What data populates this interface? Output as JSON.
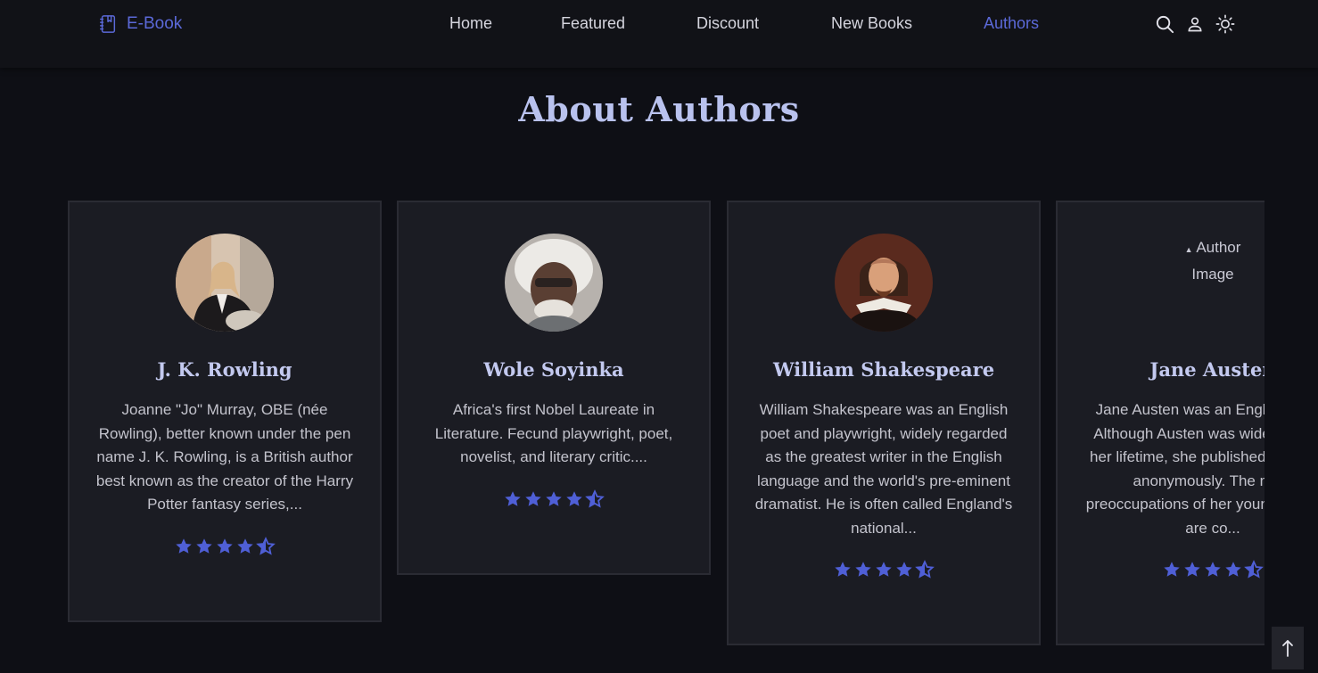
{
  "brand": {
    "name": "E-Book",
    "accent_color": "#5b69d8",
    "icon": "book-icon"
  },
  "nav": {
    "items": [
      {
        "label": "Home",
        "active": false
      },
      {
        "label": "Featured",
        "active": false
      },
      {
        "label": "Discount",
        "active": false
      },
      {
        "label": "New Books",
        "active": false
      },
      {
        "label": "Authors",
        "active": true
      }
    ]
  },
  "header_icons": [
    "search-icon",
    "user-icon",
    "sun-icon"
  ],
  "section": {
    "title": "About Authors"
  },
  "authors": [
    {
      "name": "J. K. Rowling",
      "description": "Joanne \"Jo\" Murray, OBE (née Rowling), better known under the pen name J. K. Rowling, is a British author best known as the creator of the Harry Potter fantasy series,...",
      "rating": 4.5,
      "image": "portrait"
    },
    {
      "name": "Wole Soyinka",
      "description": "Africa's first Nobel Laureate in Literature. Fecund playwright, poet, novelist, and literary critic....",
      "rating": 4.5,
      "image": "portrait"
    },
    {
      "name": "William Shakespeare",
      "description": "William Shakespeare was an English poet and playwright, widely regarded as the greatest writer in the English language and the world's pre-eminent dramatist. He is often called England's national...",
      "rating": 4.5,
      "image": "portrait"
    },
    {
      "name": "Jane Austen",
      "description": "Jane Austen was an English writer. Although Austen was widely read in her lifetime, she published her works anonymously. The most preoccupations of her young heroines are co...",
      "rating": 4.5,
      "image_alt": "Author Image",
      "image": "broken"
    }
  ],
  "colors": {
    "background": "#0e0f15",
    "card_background": "#1b1c23",
    "card_border": "#2a2b33",
    "star": "#4f5fd6",
    "title": "#b9c2ee"
  },
  "back_to_top": {
    "icon": "arrow-up-icon"
  }
}
